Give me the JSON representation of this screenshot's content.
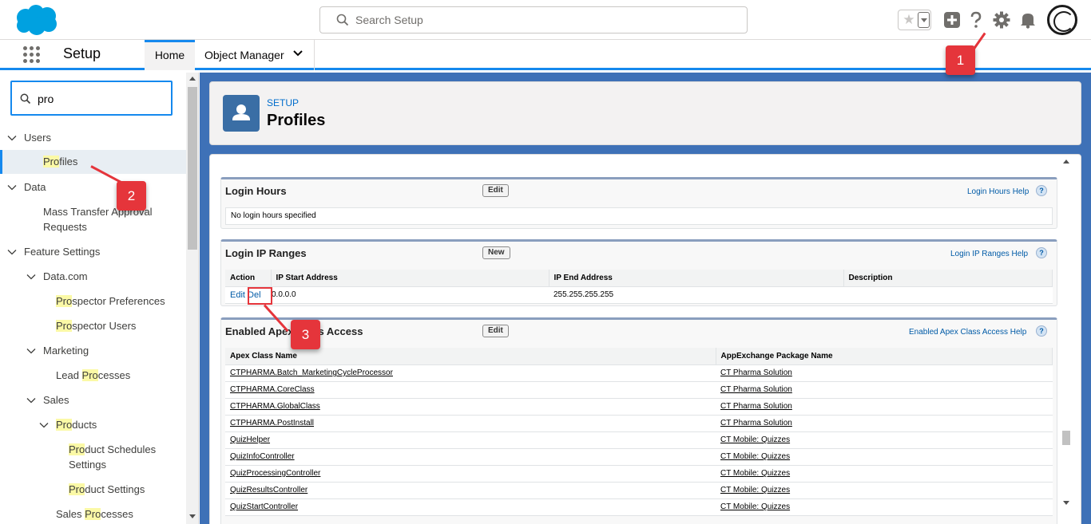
{
  "topbar": {
    "search_placeholder": "Search Setup",
    "icons": [
      "salesforce-logo",
      "search-icon",
      "star-icon",
      "add-icon",
      "help-icon",
      "gear-icon",
      "bell-icon",
      "avatar"
    ]
  },
  "navbar": {
    "app_name": "Setup",
    "tabs": [
      {
        "label": "Home"
      },
      {
        "label": "Object Manager"
      }
    ]
  },
  "sidebar": {
    "quick_find_value": "pro",
    "tree": [
      {
        "label": "Users"
      },
      {
        "label_hl": "Pro",
        "label_rest": "files"
      },
      {
        "label": "Data"
      },
      {
        "label_line1": "Mass Transfer Approval",
        "label_line2": "Requests"
      },
      {
        "label": "Feature Settings"
      },
      {
        "label": "Data.com"
      },
      {
        "label_hl": "Pro",
        "label_rest": "spector Preferences"
      },
      {
        "label_hl": "Pro",
        "label_rest": "spector Users"
      },
      {
        "label": "Marketing"
      },
      {
        "label_pre": "Lead ",
        "label_hl": "Pro",
        "label_rest": "cesses"
      },
      {
        "label": "Sales"
      },
      {
        "label_hl": "Pro",
        "label_rest": "ducts"
      },
      {
        "label_hl": "Pro",
        "label_rest": "duct Schedules",
        "label_line2": "Settings"
      },
      {
        "label_hl": "Pro",
        "label_rest": "duct Settings"
      },
      {
        "label_pre": "Sales ",
        "label_hl": "Pro",
        "label_rest": "cesses"
      }
    ]
  },
  "header": {
    "eyebrow": "SETUP",
    "title": "Profiles"
  },
  "login_hours": {
    "title": "Login Hours",
    "edit_label": "Edit",
    "help": "Login Hours Help",
    "empty": "No login hours specified"
  },
  "login_ip": {
    "title": "Login IP Ranges",
    "new_label": "New",
    "help": "Login IP Ranges Help",
    "columns": [
      "Action",
      "IP Start Address",
      "IP End Address",
      "Description"
    ],
    "rows": [
      {
        "edit": "Edit",
        "del": "Del",
        "start": "0.0.0.0",
        "end": "255.255.255.255",
        "desc": ""
      }
    ]
  },
  "apex_access": {
    "title": "Enabled Apex Class Access",
    "edit_label": "Edit",
    "help": "Enabled Apex Class Access Help",
    "columns": [
      "Apex Class Name",
      "AppExchange Package Name"
    ],
    "rows": [
      {
        "cls": "CTPHARMA.Batch_MarketingCycleProcessor",
        "pkg": "CT Pharma Solution"
      },
      {
        "cls": "CTPHARMA.CoreClass",
        "pkg": "CT Pharma Solution"
      },
      {
        "cls": "CTPHARMA.GlobalClass",
        "pkg": "CT Pharma Solution"
      },
      {
        "cls": "CTPHARMA.PostInstall",
        "pkg": "CT Pharma Solution"
      },
      {
        "cls": "QuizHelper",
        "pkg": "CT Mobile: Quizzes"
      },
      {
        "cls": "QuizInfoController",
        "pkg": "CT Mobile: Quizzes"
      },
      {
        "cls": "QuizProcessingController",
        "pkg": "CT Mobile: Quizzes"
      },
      {
        "cls": "QuizResultsController",
        "pkg": "CT Mobile: Quizzes"
      },
      {
        "cls": "QuizStartController",
        "pkg": "CT Mobile: Quizzes"
      }
    ]
  },
  "callouts": [
    "1",
    "2",
    "3"
  ],
  "colors": {
    "brand": "#1589ee",
    "link": "#015ba7",
    "callout": "#e5353b",
    "highlight": "#fbf9a6"
  }
}
